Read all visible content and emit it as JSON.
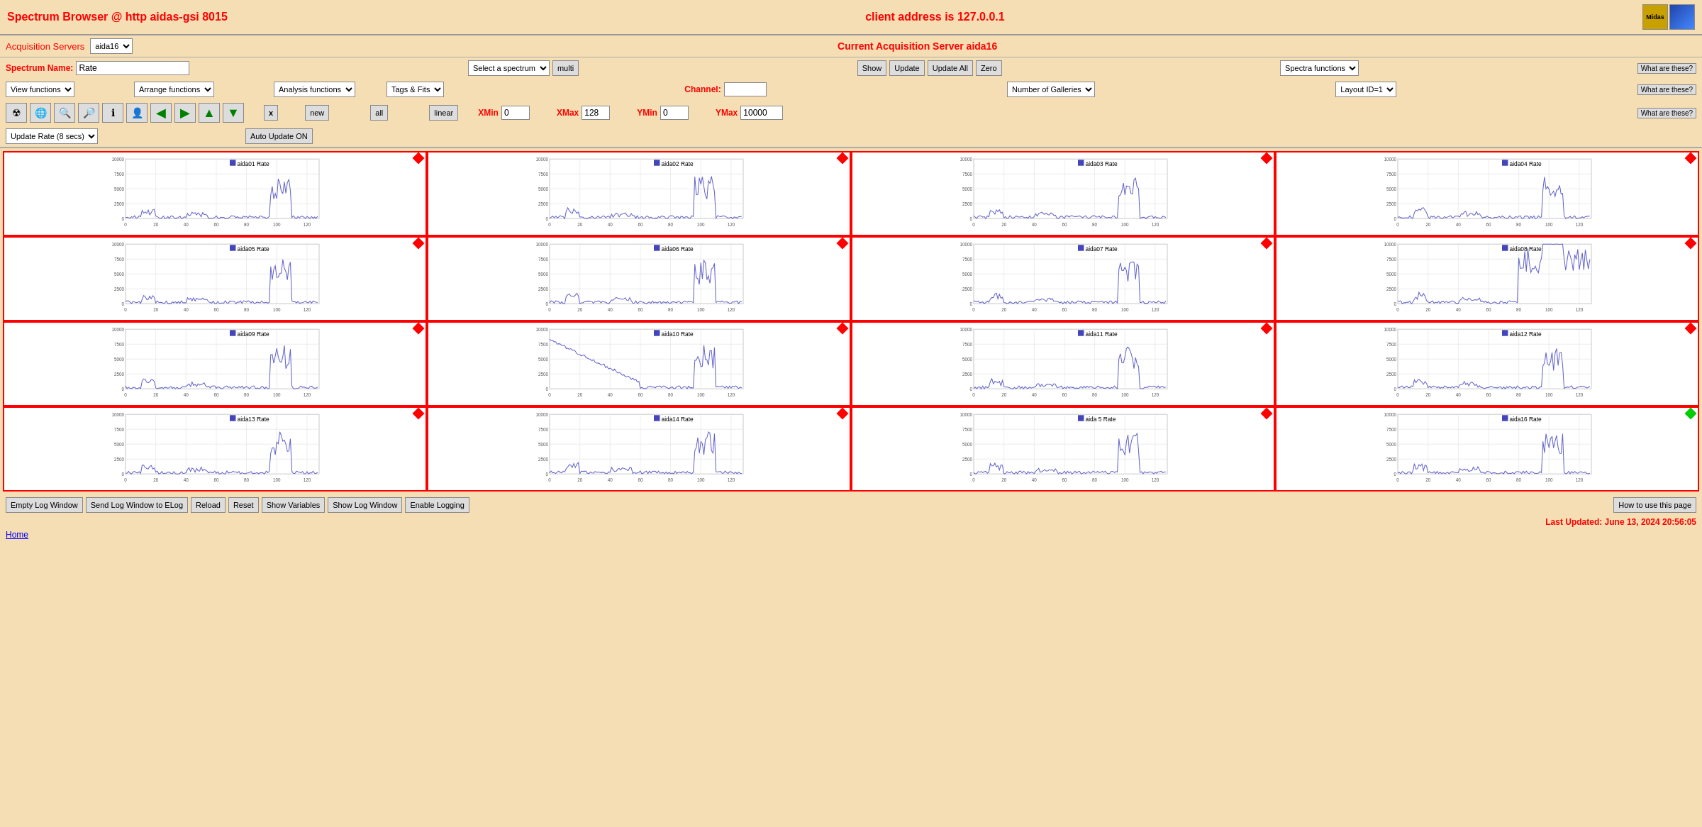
{
  "header": {
    "title": "Spectrum Browser @ http aidas-gsi 8015",
    "client": "client address is 127.0.0.1",
    "logo1": "Midas",
    "logo2": ""
  },
  "acq_server": {
    "label": "Acquisition Servers",
    "selected": "aida16",
    "options": [
      "aida16"
    ],
    "current_label": "Current Acquisition Server aida16"
  },
  "spectrum_name": {
    "label": "Spectrum Name:",
    "value": "Rate"
  },
  "dropdowns": {
    "select_spectrum": "Select a spectrum",
    "multi": "multi",
    "view_functions": "View functions",
    "arrange_functions": "Arrange functions",
    "analysis_functions": "Analysis functions",
    "tags_fits": "Tags & Fits",
    "spectra_functions": "Spectra functions",
    "number_of_galleries": "Number of Galleries",
    "layout_id": "Layout ID=1"
  },
  "buttons": {
    "show": "Show",
    "update": "Update",
    "update_all": "Update All",
    "zero": "Zero",
    "new": "new",
    "all": "all",
    "linear": "linear",
    "what_are_these1": "What are these?",
    "what_are_these2": "What are these?",
    "what_are_these3": "What are these?",
    "auto_update": "Auto Update ON",
    "update_rate": "Update Rate (8 secs)"
  },
  "axis": {
    "channel_label": "Channel:",
    "xmin_label": "XMin",
    "xmin_value": "0",
    "xmax_label": "XMax",
    "xmax_value": "128",
    "ymin_label": "YMin",
    "ymin_value": "0",
    "ymax_label": "YMax",
    "ymax_value": "10000"
  },
  "bottom_buttons": {
    "empty_log": "Empty Log Window",
    "send_log": "Send Log Window to ELog",
    "reload": "Reload",
    "reset": "Reset",
    "show_variables": "Show Variables",
    "show_log_window": "Show Log Window",
    "enable_logging": "Enable Logging",
    "how_to_use": "How to use this page"
  },
  "status": {
    "last_updated": "Last Updated: June 13, 2024 20:56:05"
  },
  "home": "Home",
  "galleries": [
    {
      "id": "aida01",
      "name": "aida01 Rate",
      "active": true,
      "diamond_color": "red"
    },
    {
      "id": "aida02",
      "name": "aida02 Rate",
      "active": true,
      "diamond_color": "red"
    },
    {
      "id": "aida03",
      "name": "aida03 Rate",
      "active": true,
      "diamond_color": "red"
    },
    {
      "id": "aida04",
      "name": "aida04 Rate",
      "active": true,
      "diamond_color": "red"
    },
    {
      "id": "aida05",
      "name": "aida05 Rate",
      "active": true,
      "diamond_color": "red"
    },
    {
      "id": "aida06",
      "name": "aida06 Rate",
      "active": true,
      "diamond_color": "red"
    },
    {
      "id": "aida07",
      "name": "aida07 Rate",
      "active": true,
      "diamond_color": "red"
    },
    {
      "id": "aida08",
      "name": "aida08 Rate",
      "active": true,
      "diamond_color": "red"
    },
    {
      "id": "aida09",
      "name": "aida09 Rate",
      "active": true,
      "diamond_color": "red"
    },
    {
      "id": "aida10",
      "name": "aida10 Rate",
      "active": true,
      "diamond_color": "red"
    },
    {
      "id": "aida11",
      "name": "aida11 Rate",
      "active": true,
      "diamond_color": "red"
    },
    {
      "id": "aida12",
      "name": "aida12 Rate",
      "active": true,
      "diamond_color": "red"
    },
    {
      "id": "aida13",
      "name": "aida13 Rate",
      "active": true,
      "diamond_color": "red"
    },
    {
      "id": "aida14",
      "name": "aida14 Rate",
      "active": true,
      "diamond_color": "red"
    },
    {
      "id": "aida15",
      "name": "aida 5 Rate",
      "active": true,
      "diamond_color": "red"
    },
    {
      "id": "aida16",
      "name": "aida16 Rate",
      "active": true,
      "diamond_color": "green"
    }
  ]
}
